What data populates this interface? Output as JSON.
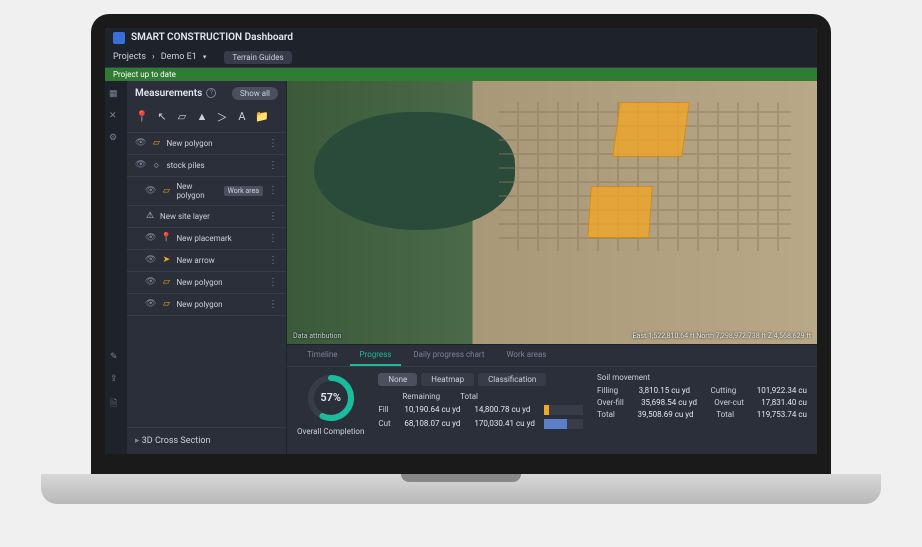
{
  "titlebar": {
    "title": "SMART CONSTRUCTION Dashboard"
  },
  "breadcrumb": {
    "projects": "Projects",
    "current": "Demo E1",
    "terrain_btn": "Terrain Guides"
  },
  "status": {
    "text": "Project up to date"
  },
  "panel": {
    "title": "Measurements",
    "show_all": "Show all",
    "items": [
      {
        "icon": "polygon",
        "label": "New polygon",
        "sub": false
      },
      {
        "icon": "circle",
        "label": "stock piles",
        "sub": false
      },
      {
        "icon": "polygon",
        "label": "New polygon",
        "sub": true,
        "tag": "Work area"
      },
      {
        "icon": "warning",
        "label": "New site layer",
        "sub": true
      },
      {
        "icon": "pin",
        "label": "New placemark",
        "sub": true
      },
      {
        "icon": "arrow",
        "label": "New arrow",
        "sub": true
      },
      {
        "icon": "polygon",
        "label": "New polygon",
        "sub": true
      },
      {
        "icon": "polygon",
        "label": "New polygon",
        "sub": true
      }
    ],
    "cross_section": "3D Cross Section"
  },
  "map": {
    "credits": "Data attribution",
    "coords": "East 1,522,810.64 ft   North 7,298,972.738 ft   Z 4,568.629 ft"
  },
  "tabs": {
    "items": [
      "Timeline",
      "Progress",
      "Daily progress chart",
      "Work areas"
    ],
    "active": 1
  },
  "progress": {
    "percent": "57%",
    "caption": "Overall Completion",
    "segments": [
      "None",
      "Heatmap",
      "Classification"
    ],
    "seg_active": 0,
    "headers": [
      "Remaining",
      "Total"
    ],
    "rows": [
      {
        "label": "Fill",
        "remaining": "10,190.64 cu yd",
        "total": "14,800.78 cu yd",
        "pct": 12,
        "cls": "fill"
      },
      {
        "label": "Cut",
        "remaining": "68,108.07 cu yd",
        "total": "170,030.41 cu yd",
        "pct": 58,
        "cls": "cut"
      }
    ]
  },
  "soil": {
    "title": "Soil movement",
    "rows": [
      {
        "l1": "Filling",
        "v1": "3,810.15 cu yd",
        "l2": "Cutting",
        "v2": "101,922.34 cu"
      },
      {
        "l1": "Over-fill",
        "v1": "35,698.54 cu yd",
        "l2": "Over-cut",
        "v2": "17,831.40 cu"
      },
      {
        "l1": "Total",
        "v1": "39,508.69 cu yd",
        "l2": "Total",
        "v2": "119,753.74 cu"
      }
    ]
  }
}
